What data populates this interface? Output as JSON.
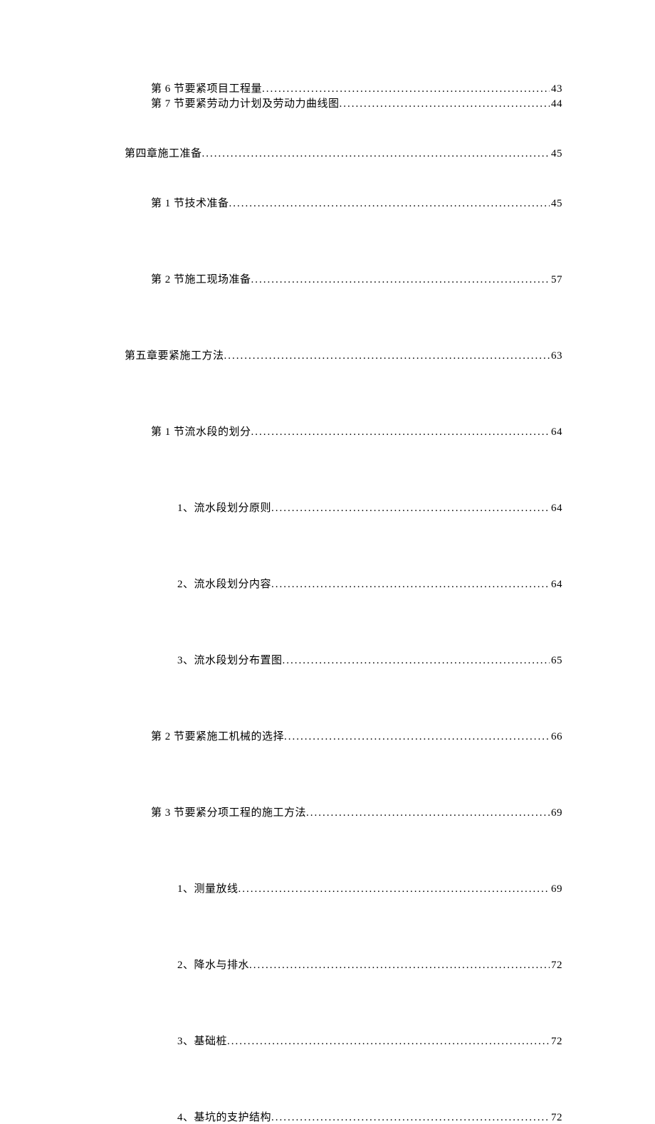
{
  "toc": [
    {
      "label": "第 6 节要紧项目工程量",
      "page": "43",
      "level": 2,
      "gapBefore": "none"
    },
    {
      "label": "第 7 节要紧劳动力计划及劳动力曲线图",
      "page": "44",
      "level": 2,
      "gapBefore": "tight"
    },
    {
      "label": "第四章施工准备",
      "page": "45",
      "level": 1,
      "gapBefore": "sm"
    },
    {
      "label": "第 1 节技术准备",
      "page": "45",
      "level": 2,
      "gapBefore": "sm"
    },
    {
      "label": "第 2 节施工现场准备",
      "page": "57",
      "level": 2,
      "gapBefore": "lg"
    },
    {
      "label": "第五章要紧施工方法",
      "page": "63",
      "level": 1,
      "gapBefore": "lg"
    },
    {
      "label": "第 1 节流水段的划分",
      "page": "64",
      "level": 2,
      "gapBefore": "lg"
    },
    {
      "label": "1、流水段划分原则",
      "page": "64",
      "level": 3,
      "gapBefore": "lg"
    },
    {
      "label": "2、流水段划分内容",
      "page": "64",
      "level": 3,
      "gapBefore": "lg"
    },
    {
      "label": "3、流水段划分布置图",
      "page": "65",
      "level": 3,
      "gapBefore": "lg"
    },
    {
      "label": "第 2 节要紧施工机械的选择",
      "page": "66",
      "level": 2,
      "gapBefore": "lg"
    },
    {
      "label": "第 3 节要紧分项工程的施工方法",
      "page": "69",
      "level": 2,
      "gapBefore": "lg"
    },
    {
      "label": "1、测量放线",
      "page": "69",
      "level": 3,
      "gapBefore": "lg"
    },
    {
      "label": "2、降水与排水",
      "page": "72",
      "level": 3,
      "gapBefore": "lg"
    },
    {
      "label": "3、基础桩",
      "page": "72",
      "level": 3,
      "gapBefore": "lg"
    },
    {
      "label": "4、基坑的支护结构",
      "page": "72",
      "level": 3,
      "gapBefore": "lg"
    }
  ]
}
